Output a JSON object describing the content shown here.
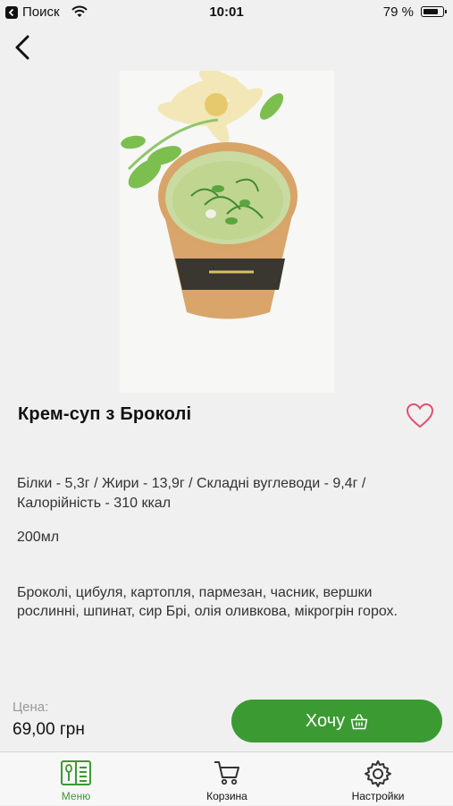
{
  "status_bar": {
    "carrier": "Поиск",
    "time": "10:01",
    "battery": "79 %"
  },
  "product": {
    "title": "Крем-суп з Броколі",
    "nutrition": "Білки - 5,3г / Жири - 13,9г / Складні вуглеводи - 9,4г / Калорійність - 310 ккал",
    "volume": "200мл",
    "ingredients": "Броколі, цибуля, картопля, пармезан, часник, вершки рослинні, шпинат, сир Брі, олія оливкова, мікрогрін горох."
  },
  "order": {
    "price_label": "Цена:",
    "price": "69,00 грн",
    "button_label": "Хочу"
  },
  "tab_bar": {
    "items": [
      {
        "label": "Меню",
        "active": true
      },
      {
        "label": "Корзина",
        "active": false
      },
      {
        "label": "Настройки",
        "active": false
      }
    ]
  },
  "colors": {
    "accent": "#3b9a32",
    "favorite": "#e0506e",
    "background": "#f0f0f0"
  },
  "icons": {
    "back": "chevron-left-icon",
    "favorite": "heart-icon",
    "button": "basket-icon",
    "tabs": [
      "menu-book-icon",
      "cart-icon",
      "gear-icon"
    ]
  }
}
